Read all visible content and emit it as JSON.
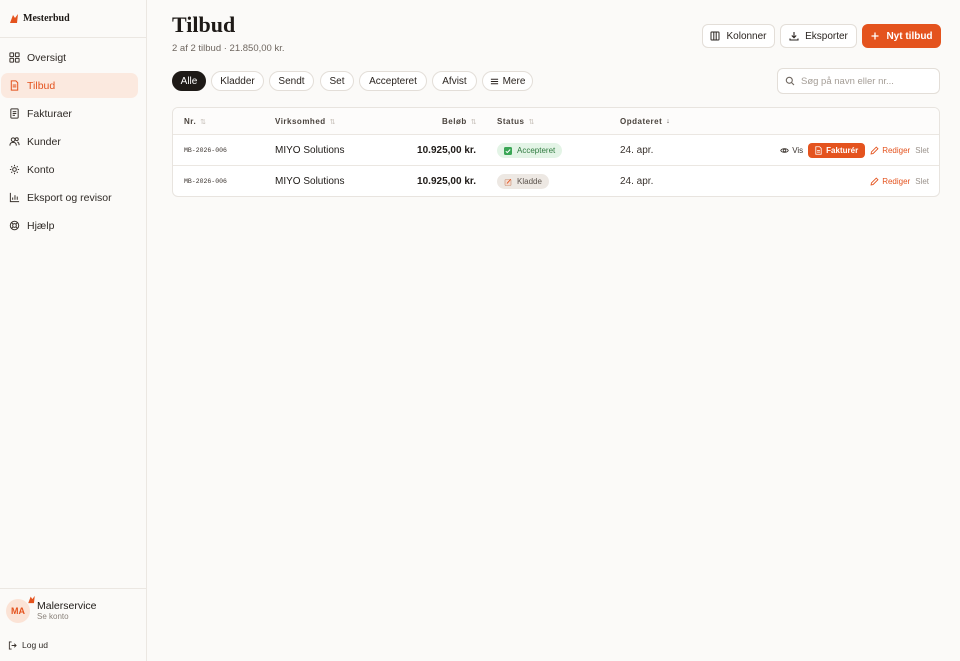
{
  "brand": {
    "name": "Mesterbud",
    "accent": "#e4531e"
  },
  "sidebar": {
    "items": [
      {
        "label": "Oversigt",
        "icon": "grid-icon",
        "active": false
      },
      {
        "label": "Tilbud",
        "icon": "document-icon",
        "active": true
      },
      {
        "label": "Fakturaer",
        "icon": "receipt-icon",
        "active": false
      },
      {
        "label": "Kunder",
        "icon": "users-icon",
        "active": false
      },
      {
        "label": "Konto",
        "icon": "gear-icon",
        "active": false
      },
      {
        "label": "Eksport og revisor",
        "icon": "bar-chart-icon",
        "active": false
      },
      {
        "label": "Hjælp",
        "icon": "lifebuoy-icon",
        "active": false
      }
    ],
    "user": {
      "initials": "MA",
      "name": "Malerservice",
      "sub": "Se konto"
    },
    "logout_label": "Log ud"
  },
  "header": {
    "title": "Tilbud",
    "subtitle": "2 af 2 tilbud · 21.850,00 kr.",
    "columns_label": "Kolonner",
    "export_label": "Eksporter",
    "new_label": "Nyt tilbud"
  },
  "filters": {
    "chips": [
      "Alle",
      "Kladder",
      "Sendt",
      "Set",
      "Accepteret",
      "Afvist"
    ],
    "more_label": "Mere",
    "active": "Alle"
  },
  "search": {
    "placeholder": "Søg på navn eller nr...",
    "value": ""
  },
  "table": {
    "headers": {
      "nr": "Nr.",
      "company": "Virksomhed",
      "amount": "Beløb",
      "status": "Status",
      "updated": "Opdateret"
    },
    "rows": [
      {
        "nr": "MB-2026-006",
        "company": "MIYO Solutions",
        "amount": "10.925,00 kr.",
        "status": "Accepteret",
        "updated": "24. apr.",
        "actions": {
          "view": "Vis",
          "invoice": "Fakturér",
          "edit": "Rediger",
          "delete": "Slet"
        }
      },
      {
        "nr": "MB-2026-006",
        "company": "MIYO Solutions",
        "amount": "10.925,00 kr.",
        "status": "Kladde",
        "updated": "24. apr.",
        "actions": {
          "edit": "Rediger",
          "delete": "Slet"
        }
      }
    ]
  }
}
